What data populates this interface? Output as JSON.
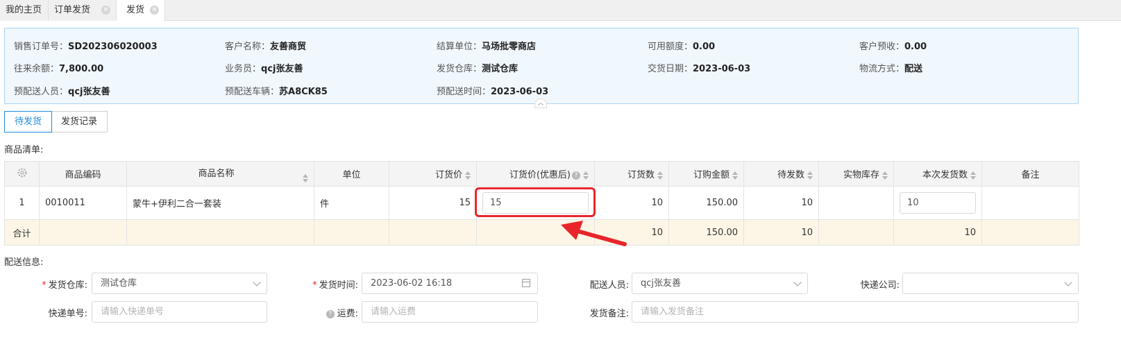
{
  "tabs": [
    {
      "label": "我的主页",
      "closable": false,
      "active": false
    },
    {
      "label": "订单发货",
      "closable": true,
      "active": false
    },
    {
      "label": "发货",
      "closable": true,
      "active": true
    }
  ],
  "info": {
    "order_no": {
      "label": "销售订单号：",
      "value": "SD202306020003"
    },
    "customer": {
      "label": "客户名称：",
      "value": "友善商贸"
    },
    "settle_unit": {
      "label": "结算单位：",
      "value": "马场批零商店"
    },
    "credit": {
      "label": "可用额度：",
      "value": "0.00"
    },
    "prepay": {
      "label": "客户预收：",
      "value": "0.00"
    },
    "balance": {
      "label": "往来余额：",
      "value": "7,800.00"
    },
    "salesman": {
      "label": "业务员：",
      "value": "qcj张友善"
    },
    "warehouse": {
      "label": "发货仓库：",
      "value": "测试仓库"
    },
    "trade_date": {
      "label": "交货日期：",
      "value": "2023-06-03"
    },
    "logistics": {
      "label": "物流方式：",
      "value": "配送"
    },
    "deliverer": {
      "label": "预配送人员：",
      "value": "qcj张友善"
    },
    "vehicle": {
      "label": "预配送车辆：",
      "value": "苏A8CK85"
    },
    "deliver_time": {
      "label": "预配送时间：",
      "value": "2023-06-03"
    }
  },
  "segments": {
    "pending": "待发货",
    "records": "发货记录"
  },
  "goods_title": "商品清单:",
  "table": {
    "headers": [
      "商品编码",
      "商品名称",
      "单位",
      "订货价",
      "订货价(优惠后)",
      "订货数",
      "订购金额",
      "待发数",
      "实物库存",
      "本次发货数",
      "备注"
    ],
    "rows": [
      {
        "idx": "1",
        "code": "0010011",
        "name": "蒙牛+伊利二合一套装",
        "unit": "件",
        "price": "15",
        "disc_price": "15",
        "qty": "10",
        "amount": "150.00",
        "pending": "10",
        "stock": "",
        "ship_qty": "10",
        "remark": ""
      }
    ],
    "total": {
      "label": "合计",
      "qty": "10",
      "amount": "150.00",
      "pending": "10",
      "ship_qty": "10"
    }
  },
  "delivery_title": "配送信息:",
  "form": {
    "warehouse": {
      "label": "发货仓库:",
      "value": "测试仓库"
    },
    "ship_time": {
      "label": "发货时间:",
      "value": "2023-06-02 16:18"
    },
    "deliverer": {
      "label": "配送人员:",
      "value": "qcj张友善"
    },
    "express_co": {
      "label": "快递公司:",
      "value": ""
    },
    "express_no": {
      "label": "快递单号:",
      "placeholder": "请输入快递单号"
    },
    "freight": {
      "label": "运费:",
      "placeholder": "请输入运费"
    },
    "remark": {
      "label": "发货备注:",
      "placeholder": "请输入发货备注"
    }
  },
  "colors": {
    "accent": "#1f8ae0",
    "highlight": "#e8252a",
    "info_bg": "#f0f7fd",
    "total_bg": "#fdf6e6"
  }
}
